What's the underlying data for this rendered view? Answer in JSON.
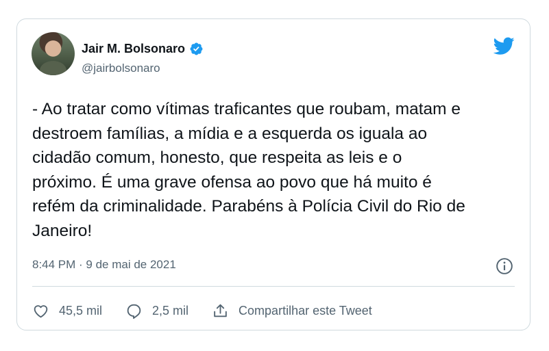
{
  "author": {
    "name": "Jair M. Bolsonaro",
    "handle": "@jairbolsonaro"
  },
  "tweet": {
    "text": "- Ao tratar como vítimas traficantes que roubam, matam e\ndestroem famílias, a mídia e a esquerda os iguala ao\ncidadão comum, honesto, que respeita as leis e o\npróximo. É uma grave ofensa ao povo que há muito é\nrefém da criminalidade. Parabéns à Polícia Civil do Rio de\nJaneiro!",
    "timestamp": "8:44 PM · 9 de mai de 2021"
  },
  "actions": {
    "likes": "45,5 mil",
    "replies": "2,5 mil",
    "share_label": "Compartilhar este Tweet"
  },
  "colors": {
    "twitter_blue": "#1d9bf0",
    "text_primary": "#0f1419",
    "text_secondary": "#536471",
    "border": "#cfd9de"
  },
  "icons": [
    "verified-badge-icon",
    "twitter-bird-icon",
    "info-icon",
    "heart-icon",
    "reply-bubble-icon",
    "share-icon"
  ]
}
